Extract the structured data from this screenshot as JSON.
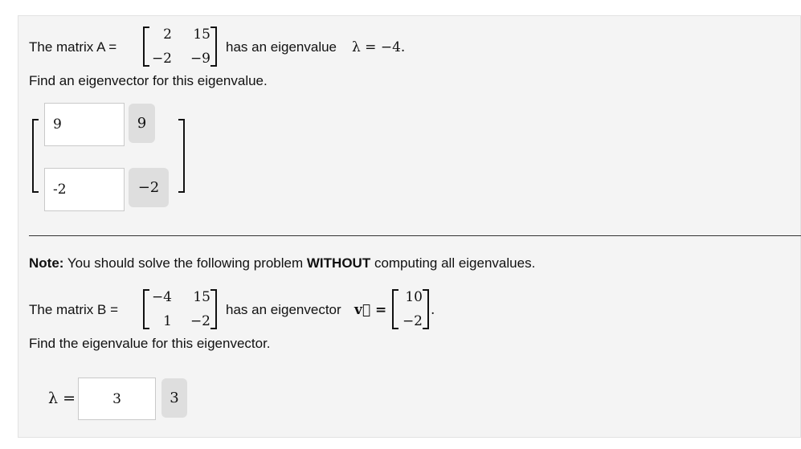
{
  "problem1": {
    "intro": "The matrix A =",
    "matrix": [
      [
        "2",
        "15"
      ],
      [
        "−2",
        "−9"
      ]
    ],
    "after_matrix": "has an eigenvalue",
    "lambda_eq": "λ = −4.",
    "instruction": "Find an eigenvector for this eigenvalue.",
    "answers": [
      {
        "value": "9",
        "preview": "9"
      },
      {
        "value": "-2",
        "preview": "−2"
      }
    ]
  },
  "problem2": {
    "note_label": "Note:",
    "note_text_1": " You should solve the following problem ",
    "note_strong": "WITHOUT",
    "note_text_2": " computing all eigenvalues.",
    "intro": "The matrix B =",
    "matrix": [
      [
        "−4",
        "15"
      ],
      [
        "1",
        "−2"
      ]
    ],
    "after_matrix": "has an eigenvector",
    "vec_symbol": "v⃗ =",
    "vector": [
      "10",
      "−2"
    ],
    "vector_end": ".",
    "instruction": "Find the eigenvalue for this eigenvector.",
    "lambda_label": "λ =",
    "answer": {
      "value": "3",
      "preview": "3"
    }
  }
}
